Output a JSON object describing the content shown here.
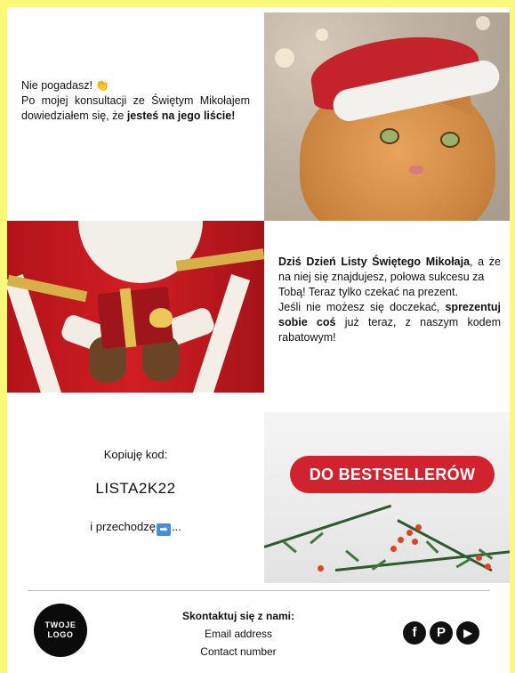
{
  "section1": {
    "line1": "Nie pogadasz!",
    "emoji": "👏",
    "line2_a": "Po mojej konsultacji ze Świętym Mikołajem dowiedziałem się, że ",
    "line2_bold": "jesteś na jego liście!"
  },
  "section2": {
    "bold1": "Dziś Dzień Listy Świętego Mikołaja",
    "t1": ", a że na niej się znajdujesz, połowa sukcesu za",
    "t2": "Tobą! Teraz tylko czekać na prezent.",
    "t3": "Jeśli nie możesz się doczekać, ",
    "bold2": "sprezentuj sobie coś",
    "t4": " już teraz, z naszym kodem rabatowym!"
  },
  "code_section": {
    "label": "Kopiuję kod:",
    "code": "LISTA2K22",
    "go_prefix": "i przechodzę",
    "arrow": "➡",
    "go_suffix": "..."
  },
  "cta": {
    "label": "DO BESTSELLERÓW"
  },
  "footer": {
    "logo_line1": "TWOJE",
    "logo_line2": "LOGO",
    "contact_heading": "Skontaktuj się z nami:",
    "email": "Email address",
    "phone": "Contact number",
    "socials": [
      "facebook-icon",
      "pinterest-icon",
      "youtube-icon"
    ]
  },
  "colors": {
    "page_background": "#fbf97a",
    "cta_red": "#d0222f"
  }
}
